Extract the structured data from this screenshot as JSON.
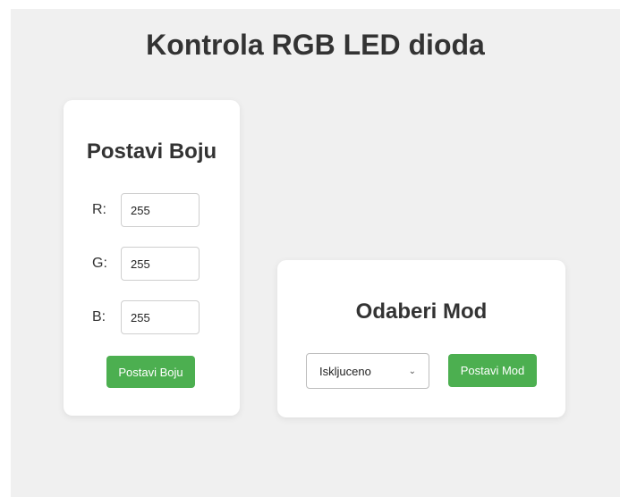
{
  "page": {
    "title": "Kontrola RGB LED dioda"
  },
  "color_card": {
    "title": "Postavi Boju",
    "fields": [
      {
        "label": "R:",
        "value": "255"
      },
      {
        "label": "G:",
        "value": "255"
      },
      {
        "label": "B:",
        "value": "255"
      }
    ],
    "submit_label": "Postavi Boju"
  },
  "mode_card": {
    "title": "Odaberi Mod",
    "selected_mode": "Iskljuceno",
    "submit_label": "Postavi Mod"
  },
  "colors": {
    "button": "#4caf50",
    "background": "#f0f0f0",
    "card": "#ffffff"
  },
  "icons": {
    "dropdown": "chevron-down-icon"
  }
}
